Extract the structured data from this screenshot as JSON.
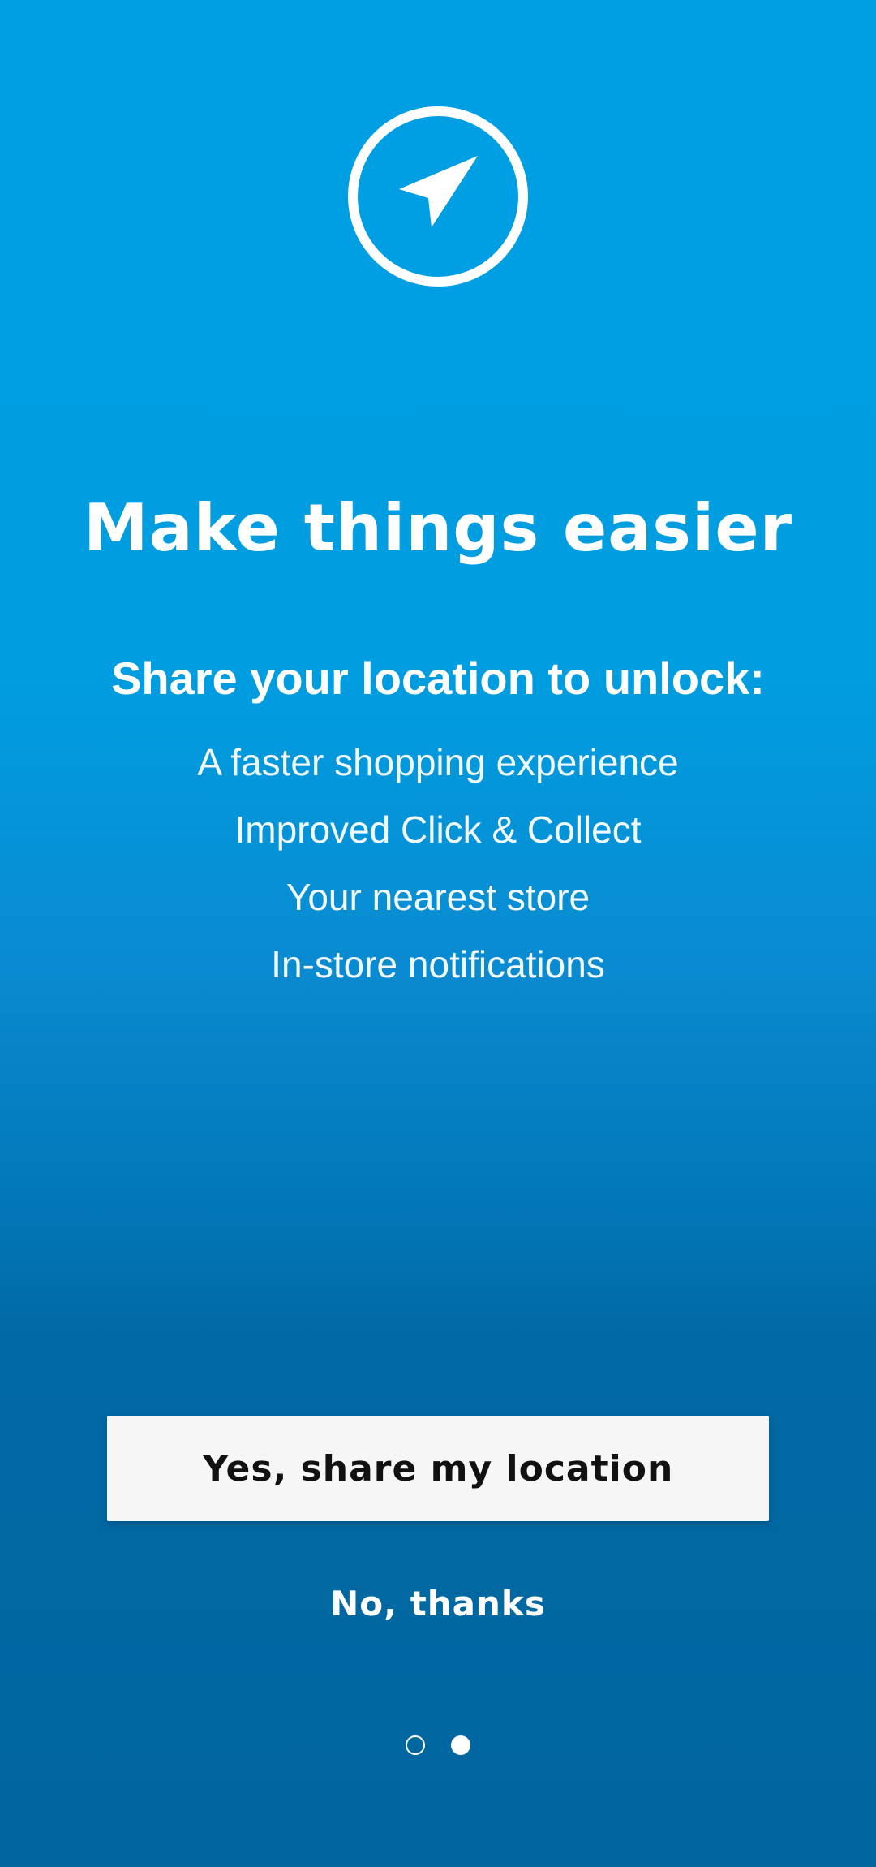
{
  "icon": {
    "name": "location-arrow-icon",
    "color": "#ffffff"
  },
  "headline": "Make things easier",
  "subheading": "Share your location to unlock:",
  "benefits": [
    "A faster shopping experience",
    "Improved Click & Collect",
    "Your nearest store",
    "In-store notifications"
  ],
  "buttons": {
    "primary_label": "Yes, share my location",
    "secondary_label": "No, thanks"
  },
  "pager": {
    "total_pages": 2,
    "current_page": 2
  },
  "colors": {
    "background_top": "#009ee2",
    "background_bottom": "#0166a0",
    "primary_button_bg": "#f6f6f6",
    "primary_button_text": "#111111"
  }
}
